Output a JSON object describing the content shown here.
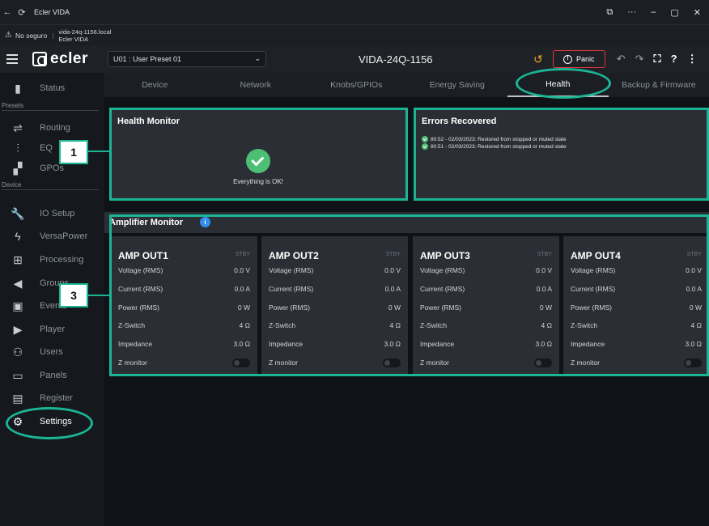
{
  "window": {
    "title": "Ecler VIDA"
  },
  "address": {
    "security": "No seguro",
    "url_line1": "vida-24q-1156.local",
    "url_line2": "Ecler VIDA"
  },
  "app": {
    "brand": "ecler",
    "preset": "U01 : User Preset 01",
    "device_name": "VIDA-24Q-1156",
    "panic_label": "Panic"
  },
  "sidebar": {
    "status": "Status",
    "presets_heading": "Presets",
    "routing": "Routing",
    "eq": "EQ",
    "gpos": "GPOs",
    "device_heading": "Device",
    "io_setup": "IO Setup",
    "versapower": "VersaPower",
    "processing": "Processing",
    "groups": "Groups",
    "events": "Events",
    "player": "Player",
    "users": "Users",
    "panels": "Panels",
    "register": "Register",
    "settings": "Settings"
  },
  "tabs": [
    "Device",
    "Network",
    "Knobs/GPIOs",
    "Energy Saving",
    "Health",
    "Backup & Firmware"
  ],
  "health": {
    "title": "Health Monitor",
    "ok_text": "Everything is OK!"
  },
  "errors": {
    "title": "Errors Recovered",
    "items": [
      "80:52 - 02/03/2023: Restored from stopped or muted state",
      "80:51 - 02/03/2023: Restored from stopped or muted state"
    ]
  },
  "amplifier": {
    "title": "Amplifier Monitor",
    "info_icon": "i",
    "labels": {
      "voltage": "Voltage (RMS)",
      "current": "Current (RMS)",
      "power": "Power (RMS)",
      "zswitch": "Z-Switch",
      "impedance": "Impedance",
      "zmonitor": "Z monitor"
    },
    "outputs": [
      {
        "name": "AMP OUT1",
        "state": "STBY",
        "voltage": "0.0 V",
        "current": "0.0 A",
        "power": "0 W",
        "zswitch": "4 Ω",
        "impedance": "3.0 Ω"
      },
      {
        "name": "AMP OUT2",
        "state": "STBY",
        "voltage": "0.0 V",
        "current": "0.0 A",
        "power": "0 W",
        "zswitch": "4 Ω",
        "impedance": "3.0 Ω"
      },
      {
        "name": "AMP OUT3",
        "state": "STBY",
        "voltage": "0.0 V",
        "current": "0.0 A",
        "power": "0 W",
        "zswitch": "4 Ω",
        "impedance": "3.0 Ω"
      },
      {
        "name": "AMP OUT4",
        "state": "STBY",
        "voltage": "0.0 V",
        "current": "0.0 A",
        "power": "0 W",
        "zswitch": "4 Ω",
        "impedance": "3.0 Ω"
      }
    ]
  },
  "callouts": {
    "c1": "1",
    "c3": "3"
  },
  "colors": {
    "highlight": "#1bb596",
    "ok": "#4bbf73",
    "panic": "#e0383a",
    "info": "#2f8ef0"
  }
}
